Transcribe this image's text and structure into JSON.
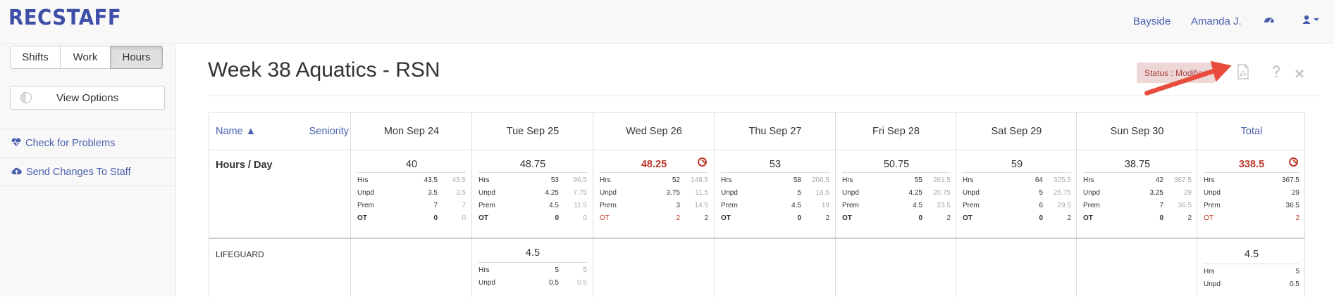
{
  "app": {
    "logo": "RECSTAFF"
  },
  "topnav": {
    "venue": "Bayside",
    "user": "Amanda J."
  },
  "sidebar": {
    "tabs": [
      {
        "label": "Shifts"
      },
      {
        "label": "Work"
      },
      {
        "label": "Hours",
        "active": true
      }
    ],
    "view_options": "View Options",
    "links": [
      {
        "label": "Check for Problems",
        "icon": "heartbeat-icon"
      },
      {
        "label": "Send Changes To Staff",
        "icon": "cloud-upload-icon"
      }
    ]
  },
  "page": {
    "title": "Week 38 Aquatics - RSN",
    "status": "Status : Modified"
  },
  "table": {
    "name_header": "Name ▲",
    "seniority_header": "Seniority",
    "columns": [
      "Mon Sep 24",
      "Tue Sep 25",
      "Wed Sep 26",
      "Thu Sep 27",
      "Fri Sep 28",
      "Sat Sep 29",
      "Sun Sep 30"
    ],
    "total_header": "Total",
    "stat_labels": [
      "Hrs",
      "Unpd",
      "Prem",
      "OT"
    ],
    "rows": [
      {
        "label": "Hours / Day",
        "cells": [
          {
            "main": "40",
            "hrs": [
              "43.5",
              "43.5"
            ],
            "unpd": [
              "3.5",
              "3.5"
            ],
            "prem": [
              "7",
              "7"
            ],
            "ot": [
              "0",
              "0"
            ]
          },
          {
            "main": "48.75",
            "hrs": [
              "53",
              "96.5"
            ],
            "unpd": [
              "4.25",
              "7.75"
            ],
            "prem": [
              "4.5",
              "11.5"
            ],
            "ot": [
              "0",
              "0"
            ]
          },
          {
            "main": "48.25",
            "warn": true,
            "hrs": [
              "52",
              "148.5"
            ],
            "unpd": [
              "3.75",
              "11.5"
            ],
            "prem": [
              "3",
              "14.5"
            ],
            "ot": [
              "2",
              "2"
            ]
          },
          {
            "main": "53",
            "hrs": [
              "58",
              "206.5"
            ],
            "unpd": [
              "5",
              "16.5"
            ],
            "prem": [
              "4.5",
              "19"
            ],
            "ot": [
              "0",
              "2"
            ]
          },
          {
            "main": "50.75",
            "hrs": [
              "55",
              "261.5"
            ],
            "unpd": [
              "4.25",
              "20.75"
            ],
            "prem": [
              "4.5",
              "23.5"
            ],
            "ot": [
              "0",
              "2"
            ]
          },
          {
            "main": "59",
            "hrs": [
              "64",
              "325.5"
            ],
            "unpd": [
              "5",
              "25.75"
            ],
            "prem": [
              "6",
              "29.5"
            ],
            "ot": [
              "0",
              "2"
            ]
          },
          {
            "main": "38.75",
            "hrs": [
              "42",
              "367.5"
            ],
            "unpd": [
              "3.25",
              "29"
            ],
            "prem": [
              "7",
              "36.5"
            ],
            "ot": [
              "0",
              "2"
            ]
          }
        ],
        "total": {
          "main": "338.5",
          "warn": true,
          "hrs": "367.5",
          "unpd": "29",
          "prem": "36.5",
          "ot": "2"
        }
      },
      {
        "label": "LIFEGUARD",
        "tue": {
          "main": "4.5",
          "hrs": [
            "5",
            "5"
          ],
          "unpd": [
            "0.5",
            "0.5"
          ]
        },
        "total": {
          "main": "4.5",
          "hrs": "5",
          "unpd": "0.5"
        }
      }
    ]
  },
  "colors": {
    "brand": "#3f4fa8",
    "link": "#4a5fae",
    "danger": "#c0392b",
    "status_bg": "#eed7d7"
  }
}
